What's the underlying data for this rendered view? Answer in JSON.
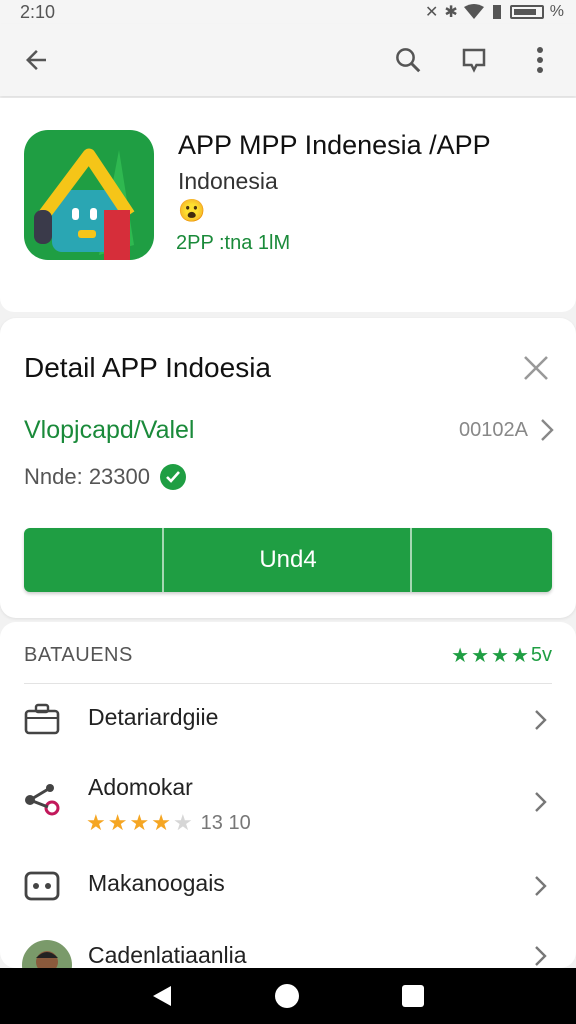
{
  "status_bar": {
    "time": "2:10",
    "right_text": "%"
  },
  "app_bar": {
    "back_icon": "arrow-left-icon",
    "search_icon": "search-icon",
    "wishlist_icon": "bookmark-icon",
    "menu_icon": "more-vert-icon"
  },
  "app_header": {
    "title": "APP MPP Indenesia /APP",
    "developer": "Indonesia",
    "emoji": "😮",
    "meta": "2PP :tna 1lM",
    "brand_color": "#1f9e43"
  },
  "detail": {
    "title": "Detail APP Indoesia",
    "link_text": "Vlopjcapd/Valel",
    "code": "00102A",
    "stat_text": "Nnde: 23300",
    "install_label": "Und4"
  },
  "list": {
    "header_title": "BATAUENS",
    "header_rating_text": "5v",
    "header_stars": 4,
    "items": [
      {
        "label": "Detariardgiie",
        "icon": "briefcase-icon"
      },
      {
        "label": "Adomokar",
        "icon": "share-node-icon",
        "rating": 4,
        "rating_text": "13 10"
      },
      {
        "label": "Makanoogais",
        "icon": "gamepad-icon"
      },
      {
        "label": "Cadenlatiaanlia",
        "icon": "avatar-icon"
      }
    ]
  },
  "nav_bar": {
    "back": "triangle-back-icon",
    "home": "circle-home-icon",
    "recents": "square-recents-icon"
  }
}
